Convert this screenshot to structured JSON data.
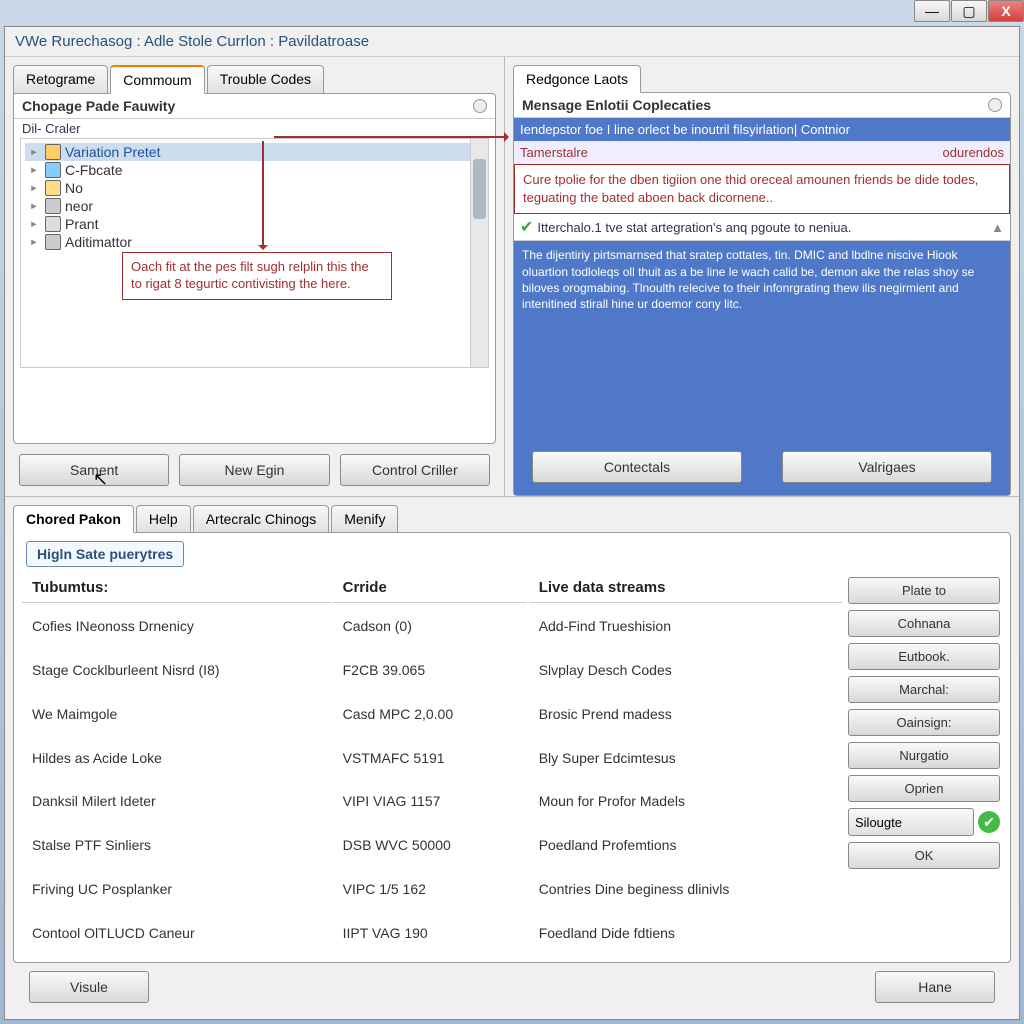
{
  "titlebar": {
    "min": "—",
    "max": "▢",
    "close": "X"
  },
  "window_title": "VWe Rurechasog : Adle Stole Currlon : Pavildatroase",
  "left": {
    "tabs": [
      "Retograme",
      "Commoum",
      "Trouble Codes"
    ],
    "active_tab": 1,
    "panel_title": "Chopage Pade Fauwity",
    "tree_label": "Dil- Craler",
    "tree_items": [
      {
        "label": "Variation Pretet",
        "selected": true
      },
      {
        "label": "C-Fbcate"
      },
      {
        "label": "No"
      },
      {
        "label": "neor"
      },
      {
        "label": "Prant"
      },
      {
        "label": "Aditimattor"
      }
    ],
    "annotation": "Oach fit at the pes filt sugh relplin this the to rigat 8 tegurtic contivisting the here.",
    "buttons": [
      "Sament",
      "New Egin",
      "Control Criller"
    ]
  },
  "right": {
    "tabs": [
      "Redgonce Laots"
    ],
    "panel_title": "Mensage Enlotii Coplecaties",
    "blue_header": "Iendepstor foe I line orlect be inoutril filsyirlation| Contnior",
    "sub_header_left": "Tamerstalre",
    "sub_header_right": "odurendos",
    "message": "Cure tpolie for the dben tigiion one thid oreceal amounen friends be dide todes, teguating the bated aboen back dicornene..",
    "check_line": "Itterchalo.1 tve stat artegration's anq pgoute to neniua.",
    "paragraph": "The dijentiriy pirtsmarnsed that sratep cottates, tin. DMIC and lbdlne niscive Hiook oluartion todloleqs oll thuit as a be line le wach calid be, demon ake the relas shoy se biloves orogmabing. Tlnoulth relecive to their infonrgrating thew ilis negirmient and intenitined stirall hine ur doemor cony litc.",
    "buttons": [
      "Contectals",
      "Valrigaes"
    ]
  },
  "lower": {
    "tabs": [
      "Chored Pakon",
      "Help",
      "Artecralc Chinogs",
      "Menify"
    ],
    "active_tab": 0,
    "section_label": "Higln Sate puerytres",
    "headers": [
      "Tubumtus:",
      "Crride",
      "Live data streams"
    ],
    "rows": [
      [
        "Cofies INeonoss Drnenicy",
        "Cadson (0)",
        "Add-Find Trueshision"
      ],
      [
        "Stage Cocklburleent Nisrd (I8)",
        "F2CB 39.065",
        "Slvplay Desch Codes"
      ],
      [
        "We Maimgole",
        "Casd MPC 2,0.00",
        "Brosic Prend madess"
      ],
      [
        "Hildes as Acide Loke",
        "VSTMAFC 5191",
        "Bly Super Edcimtesus"
      ],
      [
        "Danksil Milert Ideter",
        "VIPI VIAG 1157",
        "Moun for Profor Madels"
      ],
      [
        "Stalse PTF Sinliers",
        "DSB WVC 50000",
        "Poedland Profemtions"
      ],
      [
        "Friving UC Posplanker",
        "VIPC 1/5 162",
        "Contries Dine beginess dlinivls"
      ],
      [
        "Contool OlTLUCD Caneur",
        "IIPT VAG 190",
        "Foedland Dide fdtiens"
      ]
    ],
    "side_buttons": [
      "Plate to",
      "Cohnana",
      "Eutbook.",
      "Marchal:",
      "Oainsign:",
      "Nurgatio",
      "Oprien"
    ],
    "combo_value": "Silougte",
    "ok_label": "OK"
  },
  "footer": {
    "left": "Visule",
    "right": "Hane"
  }
}
